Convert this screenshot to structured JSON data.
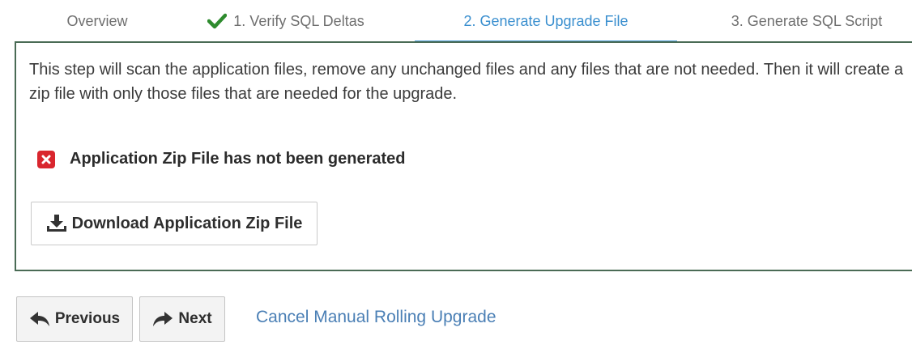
{
  "wizard": {
    "tabs": [
      {
        "label": "Overview",
        "completed": false,
        "active": false
      },
      {
        "label": "1. Verify SQL Deltas",
        "completed": true,
        "active": false
      },
      {
        "label": "2. Generate Upgrade File",
        "completed": false,
        "active": true
      },
      {
        "label": "3. Generate SQL Script",
        "completed": false,
        "active": false
      }
    ],
    "check_icon": "check-icon",
    "accent_color": "#3a8fcf",
    "check_color": "#2e8b2e"
  },
  "panel": {
    "description": "This step will scan the application files, remove any unchanged files and any files that are not needed. Then it will create a zip file with only those files that are needed for the upgrade.",
    "status": {
      "icon": "error-x-icon",
      "icon_color": "#d9262e",
      "text": "Application Zip File has not been generated"
    },
    "download_button": {
      "icon": "download-icon",
      "label": "Download Application Zip File"
    }
  },
  "footer": {
    "previous_button": {
      "icon": "reply-arrow-icon",
      "label": "Previous"
    },
    "next_button": {
      "icon": "forward-arrow-icon",
      "label": "Next"
    },
    "cancel_link": "Cancel Manual Rolling Upgrade"
  }
}
